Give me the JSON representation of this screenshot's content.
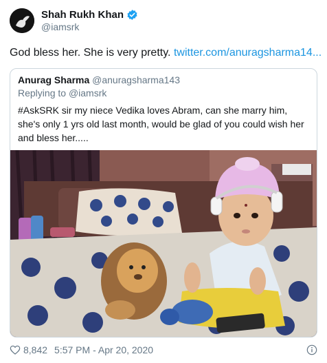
{
  "author": {
    "display_name": "Shah Rukh Khan",
    "handle": "@iamsrk",
    "verified": true
  },
  "tweet": {
    "text": "God bless her. She is very pretty.",
    "link": "twitter.com/anuragsharma14..."
  },
  "quoted_tweet": {
    "display_name": "Anurag Sharma",
    "handle": "@anuragsharma143",
    "reply_prefix": "Replying to",
    "reply_to": "@iamsrk",
    "text": "#AskSRK sir my niece Vedika loves Abram, can she marry him, she's only 1 yrs old last month, would be glad of you could wish her and bless her....."
  },
  "footer": {
    "likes": "8,842",
    "timestamp": "5:57 PM - Apr 20, 2020"
  },
  "colors": {
    "link": "#1b95e0",
    "verified": "#1da1f2",
    "secondary_text": "#657786",
    "border": "#ccd6dd"
  }
}
